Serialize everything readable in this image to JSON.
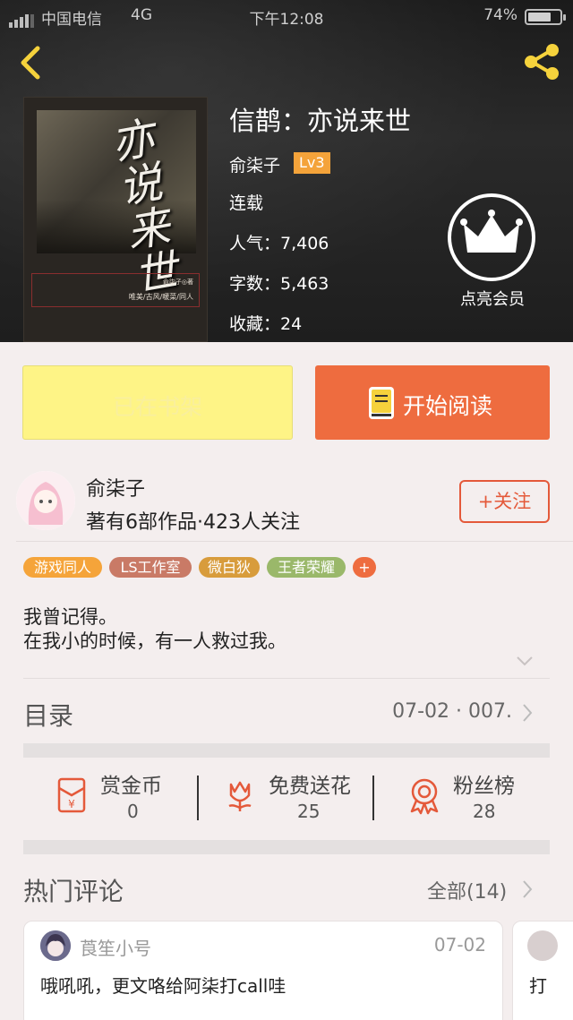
{
  "status_bar": {
    "carrier": "中国电信",
    "network": "4G",
    "time": "下午12:08",
    "battery": "74%",
    "battery_level": 0.74
  },
  "nav": {
    "back_icon": "chevron-left-icon",
    "share_icon": "share-icon"
  },
  "book": {
    "title": "信鹊：亦说来世",
    "author": "俞柒子",
    "level": "Lv3",
    "status": "连载",
    "popularity": "人气：7,406",
    "word_count": "字数：5,463",
    "favorites": "收藏：24",
    "cover_text": {
      "title": "亦说来世",
      "credit": "俞柒子◎著",
      "genres": "唯美/古风/暖菜/同人"
    }
  },
  "vip": {
    "label": "点亮会员",
    "icon": "crown-icon"
  },
  "actions": {
    "shelf_label": "已在书架",
    "read_label": "开始阅读"
  },
  "author": {
    "name": "俞柒子",
    "meta": "著有6部作品·423人关注",
    "follow_label": "+关注"
  },
  "tags": [
    {
      "label": "游戏同人",
      "color": "#f5a43a"
    },
    {
      "label": "LS工作室",
      "color": "#c97a66"
    },
    {
      "label": "微白狄",
      "color": "#d89c3c"
    },
    {
      "label": "王者荣耀",
      "color": "#9ab86a"
    },
    {
      "label": "+",
      "color": "#ee6c3f"
    }
  ],
  "description": {
    "line1": "我曾记得。",
    "line2": "在我小的时候，有一人救过我。"
  },
  "toc": {
    "label": "目录",
    "latest": "07-02 · 007."
  },
  "stats": [
    {
      "label": "赏金币",
      "value": "0",
      "icon": "red-envelope-icon"
    },
    {
      "label": "免费送花",
      "value": "25",
      "icon": "flower-icon"
    },
    {
      "label": "粉丝榜",
      "value": "28",
      "icon": "medal-icon"
    }
  ],
  "comments": {
    "label": "热门评论",
    "all_label": "全部(14)",
    "items": [
      {
        "user": "莨笙小号",
        "date": "07-02",
        "text": "哦吼吼，更文咯给阿柒打call哇"
      },
      {
        "text": "打"
      }
    ]
  },
  "colors": {
    "accent": "#ee6c3f",
    "shelf": "#fef486",
    "header_bg": "#222222"
  }
}
